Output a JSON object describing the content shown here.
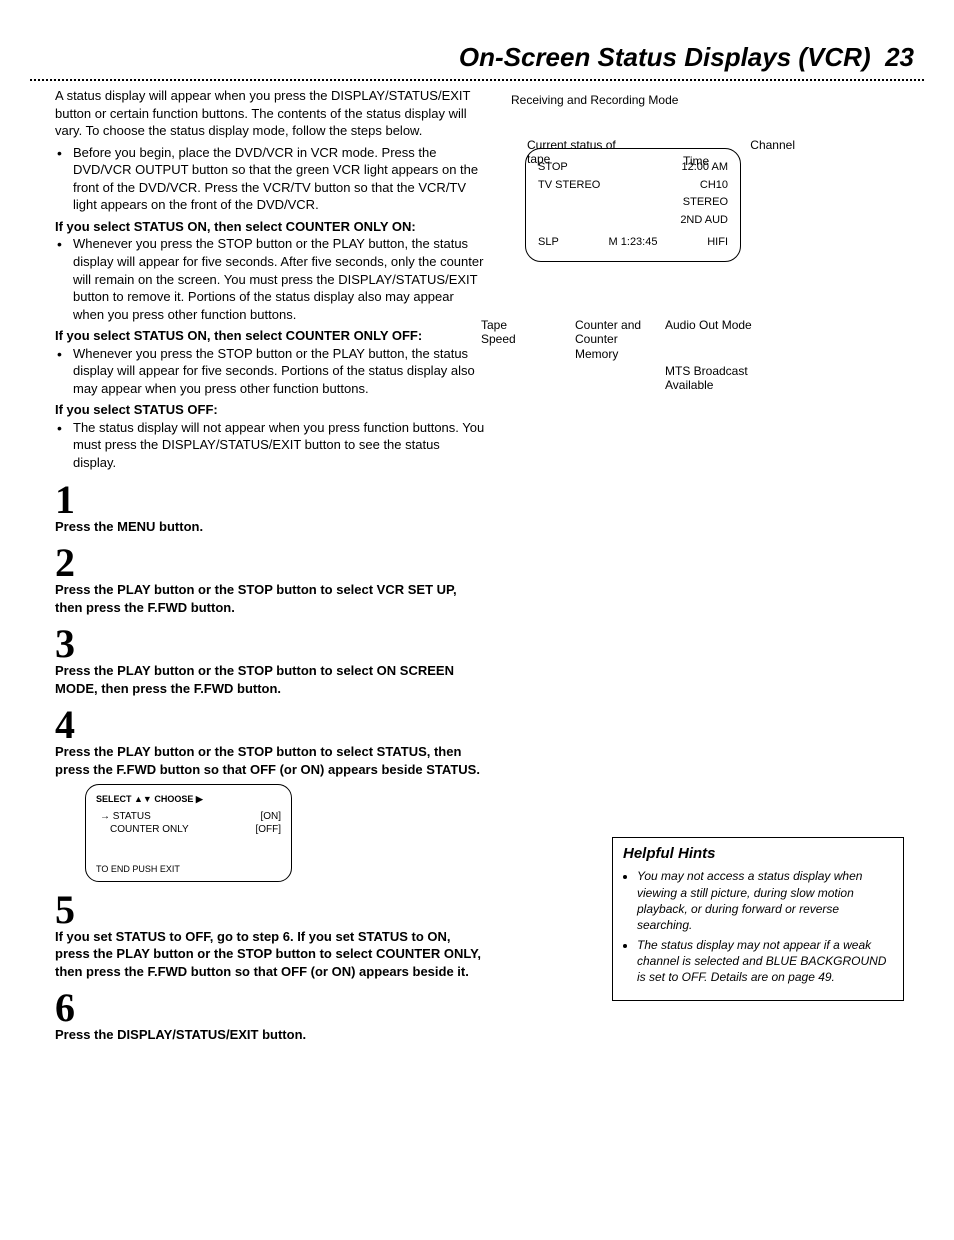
{
  "page": {
    "title": "On-Screen Status Displays (VCR)",
    "number": "23",
    "intro": "A status display will appear when you press the DISPLAY/STATUS/EXIT button or certain function buttons. The contents of the status display will vary. To choose the status display mode, follow the steps below.",
    "prep_bullet": "Before you begin, place the DVD/VCR in VCR mode. Press the DVD/VCR OUTPUT button so that the green VCR light appears on the front of the DVD/VCR. Press the VCR/TV button so that the VCR/TV light appears on the front of the DVD/VCR.",
    "opt1_title": "If you select STATUS ON, then select COUNTER ONLY ON:",
    "opt1_bullet": "Whenever you press the STOP button or the PLAY button, the status display will appear for five seconds. After five seconds, only the counter will remain on the screen. You must press the DISPLAY/STATUS/EXIT button to remove it. Portions of the status display also may appear when you press other function buttons.",
    "opt2_title": "If you select STATUS ON, then select COUNTER ONLY OFF:",
    "opt2_bullet": "Whenever you press the STOP button or the PLAY button, the status display will appear for five seconds. Portions of the status display also may appear when you press other function buttons.",
    "opt3_title": "If you select STATUS OFF:",
    "opt3_bullet": "The status display will not appear when you press function buttons. You must press the DISPLAY/STATUS/EXIT button to see the status display."
  },
  "steps": {
    "s1": "Press the MENU button.",
    "s2": "Press the PLAY button or the STOP button to select VCR SET UP, then press the F.FWD button.",
    "s3": "Press the PLAY button or the STOP button to select ON SCREEN MODE, then press the F.FWD button.",
    "s4": "Press the PLAY button or the STOP button to select STATUS, then press the F.FWD button so that OFF (or ON) appears beside STATUS.",
    "s5": "If you set STATUS to OFF, go to step 6. If you set STATUS to ON, press the PLAY button or the STOP button to select COUNTER ONLY, then press the F.FWD button so that OFF (or ON) appears beside it.",
    "s6": "Press the DISPLAY/STATUS/EXIT button."
  },
  "menu": {
    "header": "SELECT ▲▼ CHOOSE ▶",
    "row1_l": "→ STATUS",
    "row1_r": "[ON]",
    "row2_l": "COUNTER ONLY",
    "row2_r": "[OFF]",
    "footer": "TO END PUSH EXIT"
  },
  "hints": {
    "title": "Helpful Hints",
    "h1": "You may not access a status display when viewing a still picture, during slow motion playback, or during forward or reverse searching.",
    "h2": "The status display may not appear if a weak channel is selected and BLUE BACKGROUND is set to OFF. Details are on page 49."
  },
  "diagram": {
    "title": "Receiving and Recording Mode",
    "screen": {
      "r1a": "STOP",
      "r1b": "12:00 AM",
      "r2a": "TV STEREO",
      "r2b": "CH10",
      "r3b": "STEREO",
      "r4b": "2ND AUD",
      "r5a": "SLP",
      "r5b": "M 1:23:45",
      "r5c": "HIFI"
    },
    "labels": {
      "current_status": "Current status of tape",
      "channel": "Channel",
      "time": "Time",
      "tape_speed": "Tape Speed",
      "counter": "Counter and Counter Memory",
      "audio_out": "Audio Out Mode",
      "mts": "MTS Broadcast Available"
    }
  }
}
